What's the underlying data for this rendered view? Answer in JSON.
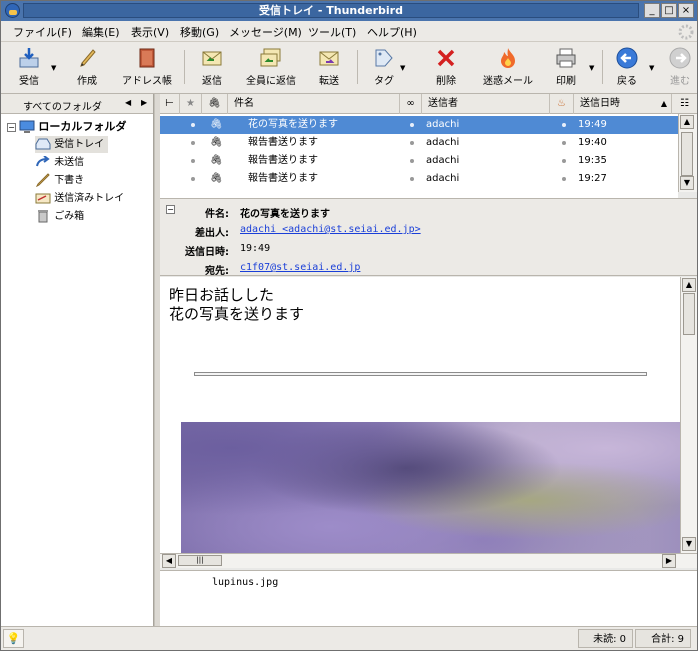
{
  "window": {
    "title": "受信トレイ - Thunderbird"
  },
  "menu": [
    "ファイル(F)",
    "編集(E)",
    "表示(V)",
    "移動(G)",
    "メッセージ(M)",
    "ツール(T)",
    "ヘルプ(H)"
  ],
  "toolbar": {
    "get_mail": "受信",
    "write": "作成",
    "address_book": "アドレス帳",
    "reply": "返信",
    "reply_all": "全員に返信",
    "forward": "転送",
    "tag": "タグ",
    "delete": "削除",
    "junk": "迷惑メール",
    "print": "印刷",
    "back": "戻る",
    "forward_nav": "進む"
  },
  "folders": {
    "header": "すべてのフォルダ",
    "root": "ローカルフォルダ",
    "items": [
      "受信トレイ",
      "未送信",
      "下書き",
      "送信済みトレイ",
      "ごみ箱"
    ]
  },
  "columns": {
    "subject": "件名",
    "sender": "送信者",
    "date": "送信日時"
  },
  "messages": [
    {
      "subject": "花の写真を送ります",
      "sender": "adachi",
      "date": "19:49"
    },
    {
      "subject": "報告書送ります",
      "sender": "adachi",
      "date": "19:40"
    },
    {
      "subject": "報告書送ります",
      "sender": "adachi",
      "date": "19:35"
    },
    {
      "subject": "報告書送ります",
      "sender": "adachi",
      "date": "19:27"
    }
  ],
  "header_labels": {
    "subject": "件名:",
    "from": "差出人:",
    "date": "送信日時:",
    "to": "宛先:"
  },
  "header_values": {
    "subject": "花の写真を送ります",
    "from": "adachi <adachi@st.seiai.ed.jp>",
    "date": "19:49",
    "to": "c1f07@st.seiai.ed.jp"
  },
  "body": {
    "line1": "昨日お話しした",
    "line2": "花の写真を送ります"
  },
  "attachment": {
    "name": "lupinus.jpg"
  },
  "status": {
    "unread": "未読: 0",
    "total": "合計: 9"
  },
  "colors": {
    "accent": "#4f8ad4",
    "title_bar": "#4a74ad",
    "link": "#1a3fd8"
  }
}
